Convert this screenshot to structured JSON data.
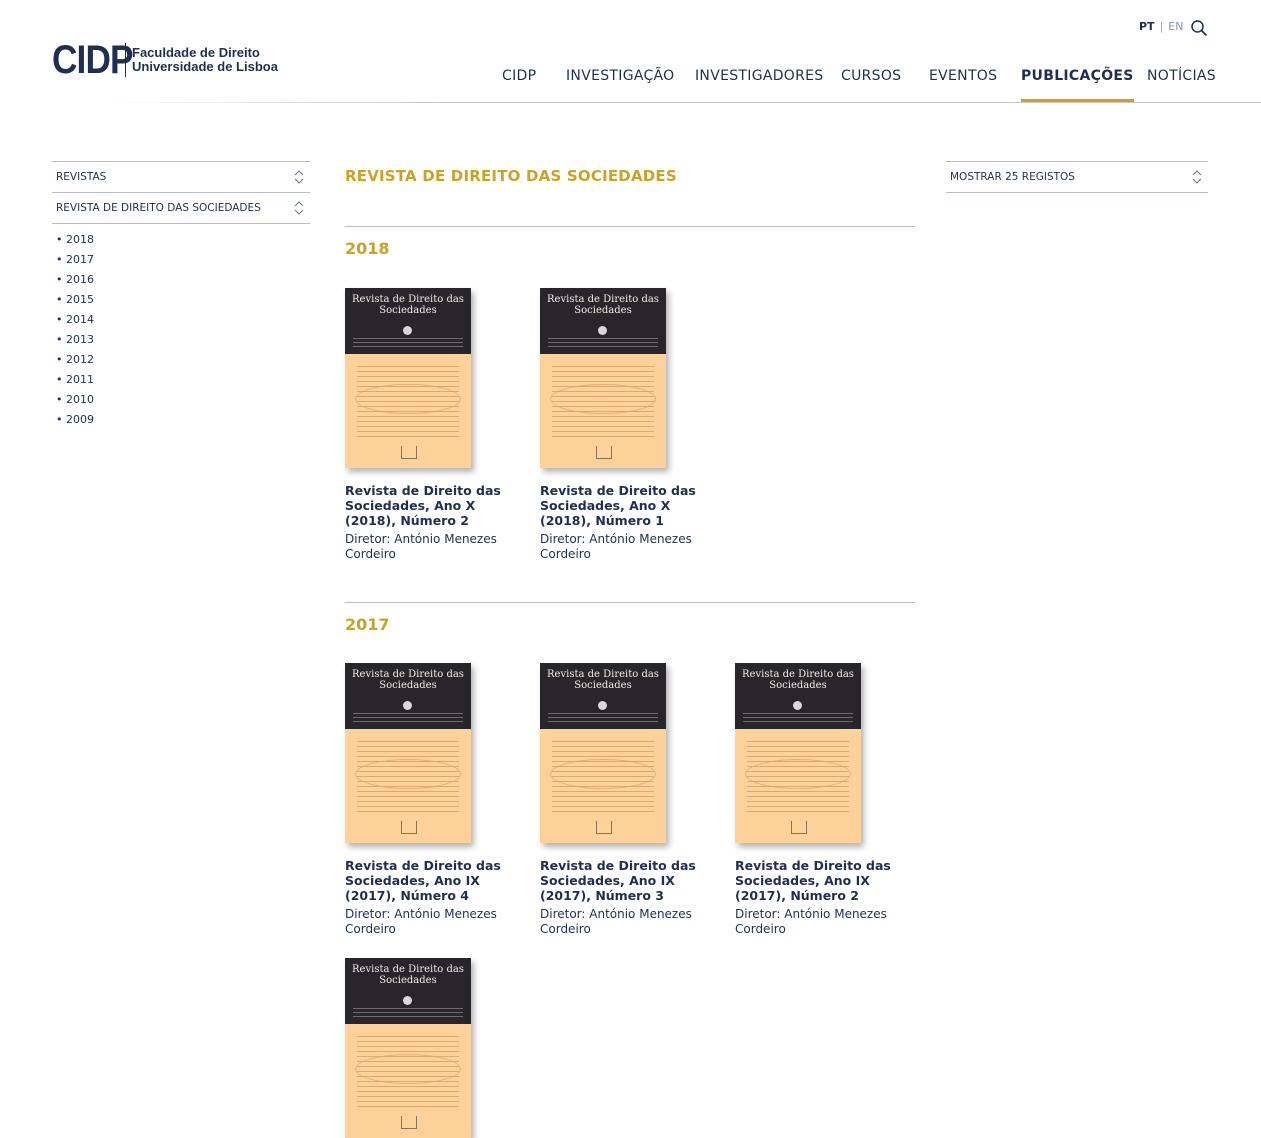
{
  "header": {
    "logo_mark": "CIDP",
    "logo_line1": "Faculdade de Direito",
    "logo_line2": "Universidade de Lisboa",
    "lang_pt": "PT",
    "lang_sep": "|",
    "lang_en": "EN",
    "nav": [
      "CIDP",
      "INVESTIGAÇÃO",
      "INVESTIGADORES",
      "CURSOS",
      "EVENTOS",
      "PUBLICAÇÕES",
      "NOTÍCIAS"
    ],
    "active_nav": "PUBLICAÇÕES"
  },
  "sidebar": {
    "select_type": "REVISTAS",
    "select_journal": "REVISTA DE DIREITO DAS SOCIEDADES",
    "years": [
      "2018",
      "2017",
      "2016",
      "2015",
      "2014",
      "2013",
      "2012",
      "2011",
      "2010",
      "2009"
    ]
  },
  "main": {
    "title": "REVISTA DE DIREITO DAS SOCIEDADES",
    "sections": [
      {
        "year": "2018",
        "items": [
          {
            "title": "Revista de Direito das Sociedades, Ano X (2018), Número 2",
            "director": "Diretor: António Menezes Cordeiro",
            "cover_title": "Revista de Direito das Sociedades"
          },
          {
            "title": "Revista de Direito das Sociedades, Ano X (2018), Número 1",
            "director": "Diretor: António Menezes Cordeiro",
            "cover_title": "Revista de Direito das Sociedades"
          }
        ]
      },
      {
        "year": "2017",
        "items": [
          {
            "title": "Revista de Direito das Sociedades, Ano IX (2017), Número 4",
            "director": "Diretor: António Menezes Cordeiro",
            "cover_title": "Revista de Direito das Sociedades"
          },
          {
            "title": "Revista de Direito das Sociedades, Ano IX (2017), Número 3",
            "director": "Diretor: António Menezes Cordeiro",
            "cover_title": "Revista de Direito das Sociedades"
          },
          {
            "title": "Revista de Direito das Sociedades, Ano IX (2017), Número 2",
            "director": "Diretor: António Menezes Cordeiro",
            "cover_title": "Revista de Direito das Sociedades"
          },
          {
            "cover_title": "Revista de Direito das Sociedades"
          }
        ]
      }
    ]
  },
  "right": {
    "select_count": "MOSTRAR 25 REGISTOS"
  }
}
